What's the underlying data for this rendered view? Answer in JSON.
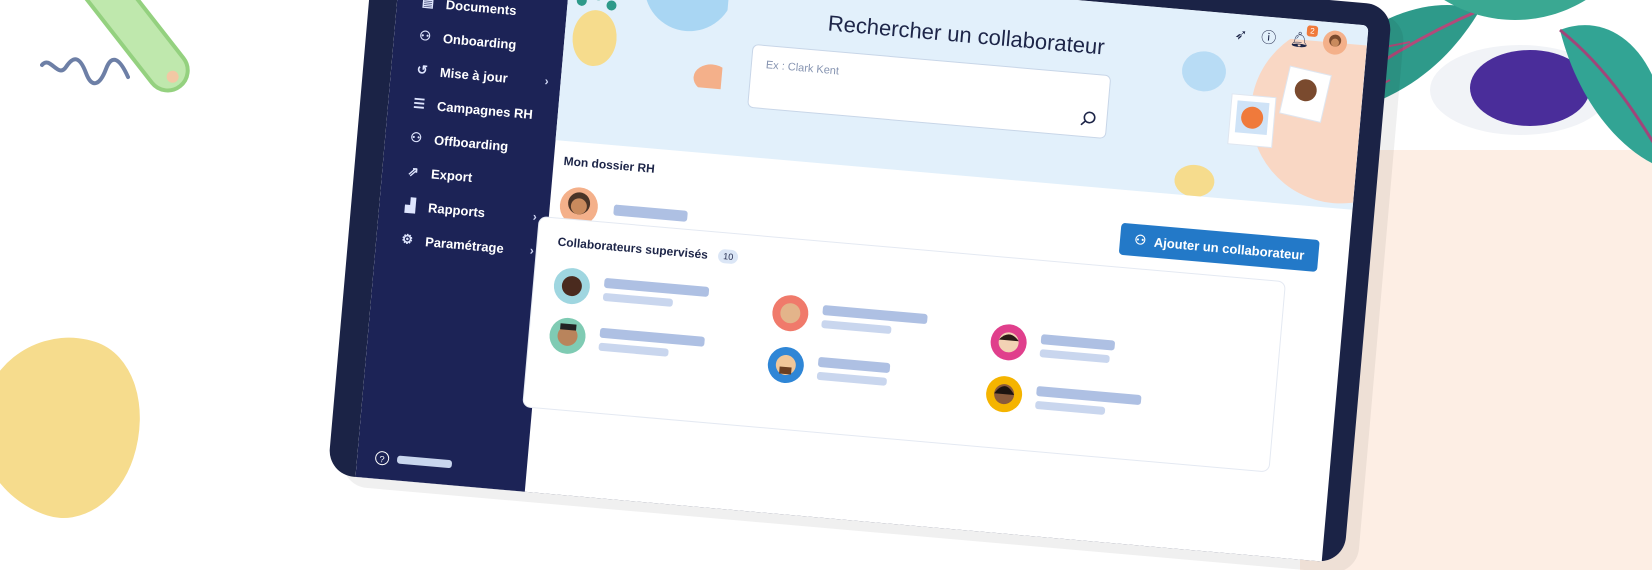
{
  "sidebar": {
    "active_item": "",
    "items": [
      {
        "label": "Documents",
        "icon": "document-icon",
        "has_chevron": false
      },
      {
        "label": "Onboarding",
        "icon": "user-plus-icon",
        "has_chevron": false
      },
      {
        "label": "Mise à jour",
        "icon": "refresh-icon",
        "has_chevron": true
      },
      {
        "label": "Campagnes RH",
        "icon": "checklist-icon",
        "has_chevron": false
      },
      {
        "label": "Offboarding",
        "icon": "user-minus-icon",
        "has_chevron": false
      },
      {
        "label": "Export",
        "icon": "external-link-icon",
        "has_chevron": false
      },
      {
        "label": "Rapports",
        "icon": "bar-chart-icon",
        "has_chevron": true
      },
      {
        "label": "Paramétrage",
        "icon": "gear-icon",
        "has_chevron": true
      }
    ]
  },
  "hero": {
    "title": "Rechercher un collaborateur",
    "search_placeholder": "Ex : Clark Kent"
  },
  "topbar": {
    "icons": [
      "rocket-icon",
      "info-icon",
      "bell-icon",
      "user-avatar"
    ],
    "notification_count": "2"
  },
  "my_file": {
    "title": "Mon dossier RH"
  },
  "actions": {
    "add_collaborator_label": "Ajouter un collaborateur"
  },
  "supervised": {
    "title": "Collaborateurs supervisés",
    "count": "10"
  },
  "colors": {
    "sidebar_bg": "#1c2356",
    "accent": "#2379c8",
    "hero_bg": "#e2f0fb",
    "badge": "#f07a3b"
  }
}
